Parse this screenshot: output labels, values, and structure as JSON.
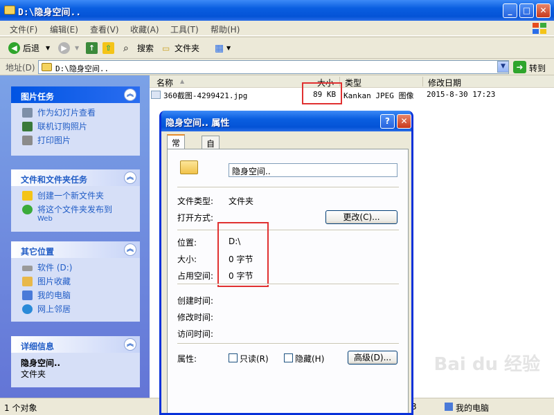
{
  "window": {
    "title": "D:\\隐身空间..",
    "menu": [
      "文件(F)",
      "编辑(E)",
      "查看(V)",
      "收藏(A)",
      "工具(T)",
      "帮助(H)"
    ]
  },
  "toolbar": {
    "back": "后退",
    "search": "搜索",
    "folders": "文件夹"
  },
  "address": {
    "label": "地址(D)",
    "path": "D:\\隐身空间..",
    "go": "转到"
  },
  "panels": {
    "picture_tasks": {
      "title": "图片任务",
      "items": [
        "作为幻灯片查看",
        "联机订购照片",
        "打印图片"
      ]
    },
    "file_tasks": {
      "title": "文件和文件夹任务",
      "items": [
        "创建一个新文件夹",
        "将这个文件夹发布到"
      ],
      "sub": "Web"
    },
    "other_places": {
      "title": "其它位置",
      "items": [
        "软件 (D:)",
        "图片收藏",
        "我的电脑",
        "网上邻居"
      ]
    },
    "details": {
      "title": "详细信息",
      "name": "隐身空间..",
      "type": "文件夹"
    }
  },
  "columns": {
    "name": "名称",
    "size": "大小",
    "type": "类型",
    "modified": "修改日期"
  },
  "file": {
    "name": "360截图-4299421.jpg",
    "size": "89 KB",
    "type": "Kankan JPEG 图像",
    "date": "2015-8-30 17:23"
  },
  "status": {
    "left": "1 个对象",
    "mid": "3",
    "right": "我的电脑"
  },
  "dialog": {
    "title": "隐身空间.. 属性",
    "tabs": [
      "常规",
      "自定义"
    ],
    "name": "隐身空间..",
    "labels": {
      "type": "文件类型:",
      "open": "打开方式:",
      "location": "位置:",
      "size": "大小:",
      "disk": "占用空间:",
      "created": "创建时间:",
      "modified": "修改时间:",
      "accessed": "访问时间:",
      "attrs": "属性:"
    },
    "values": {
      "type": "文件夹",
      "location": "D:\\",
      "size": "0 字节",
      "disk": "0 字节"
    },
    "buttons": {
      "change": "更改(C)...",
      "advanced": "高级(D)..."
    },
    "attrs": {
      "readonly": "只读(R)",
      "hidden": "隐藏(H)"
    }
  },
  "watermark": "Bai du 经验",
  "colors": {
    "accent": "#0054e3",
    "highlight": "#e03030"
  }
}
